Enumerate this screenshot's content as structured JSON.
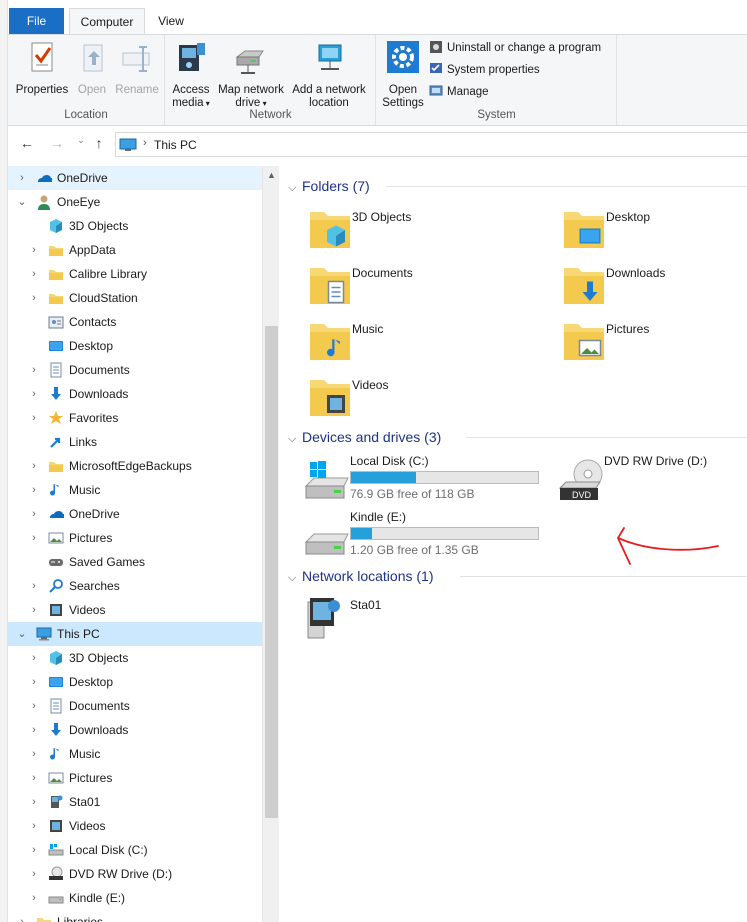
{
  "ribbon": {
    "tabs": [
      "File",
      "Computer",
      "View"
    ],
    "location": {
      "label": "Location",
      "properties": "Properties",
      "open": "Open",
      "rename": "Rename"
    },
    "network": {
      "label": "Network",
      "access_media_1": "Access",
      "access_media_2": "media",
      "map_drive_1": "Map network",
      "map_drive_2": "drive",
      "add_location_1": "Add a network",
      "add_location_2": "location"
    },
    "system": {
      "label": "System",
      "open_settings_1": "Open",
      "open_settings_2": "Settings",
      "uninstall": "Uninstall or change a program",
      "system_properties": "System properties",
      "manage": "Manage"
    }
  },
  "address": {
    "path": "This PC"
  },
  "nav": {
    "items": [
      {
        "label": "OneDrive",
        "icon": "onedrive-icon",
        "expanded": false
      },
      {
        "label": "OneEye",
        "icon": "user-icon",
        "expanded": true
      },
      {
        "label": "3D Objects",
        "icon": "3d-objects-icon"
      },
      {
        "label": "AppData",
        "icon": "folder-icon"
      },
      {
        "label": "Calibre Library",
        "icon": "folder-icon"
      },
      {
        "label": "CloudStation",
        "icon": "folder-icon"
      },
      {
        "label": "Contacts",
        "icon": "contacts-icon"
      },
      {
        "label": "Desktop",
        "icon": "desktop-icon"
      },
      {
        "label": "Documents",
        "icon": "documents-icon"
      },
      {
        "label": "Downloads",
        "icon": "downloads-icon"
      },
      {
        "label": "Favorites",
        "icon": "favorites-icon"
      },
      {
        "label": "Links",
        "icon": "links-icon"
      },
      {
        "label": "MicrosoftEdgeBackups",
        "icon": "folder-icon"
      },
      {
        "label": "Music",
        "icon": "music-icon"
      },
      {
        "label": "OneDrive",
        "icon": "onedrive-icon"
      },
      {
        "label": "Pictures",
        "icon": "pictures-icon"
      },
      {
        "label": "Saved Games",
        "icon": "saved-games-icon"
      },
      {
        "label": "Searches",
        "icon": "search-icon"
      },
      {
        "label": "Videos",
        "icon": "videos-icon"
      },
      {
        "label": "This PC",
        "icon": "this-pc-icon",
        "expanded": true
      },
      {
        "label": "3D Objects",
        "icon": "3d-objects-icon"
      },
      {
        "label": "Desktop",
        "icon": "desktop-icon"
      },
      {
        "label": "Documents",
        "icon": "documents-icon"
      },
      {
        "label": "Downloads",
        "icon": "downloads-icon"
      },
      {
        "label": "Music",
        "icon": "music-icon"
      },
      {
        "label": "Pictures",
        "icon": "pictures-icon"
      },
      {
        "label": "Sta01",
        "icon": "network-drive-icon"
      },
      {
        "label": "Videos",
        "icon": "videos-icon"
      },
      {
        "label": "Local Disk (C:)",
        "icon": "local-disk-icon"
      },
      {
        "label": "DVD RW Drive (D:)",
        "icon": "dvd-drive-icon"
      },
      {
        "label": "Kindle (E:)",
        "icon": "removable-drive-icon"
      },
      {
        "label": "Libraries",
        "icon": "libraries-icon"
      }
    ]
  },
  "sections": {
    "folders": "Folders (7)",
    "devices": "Devices and drives (3)",
    "network": "Network locations (1)"
  },
  "folders": [
    "3D Objects",
    "Desktop",
    "Documents",
    "Downloads",
    "Music",
    "Pictures",
    "Videos"
  ],
  "drives": [
    {
      "name": "Local Disk (C:)",
      "free": "76.9 GB free of 118 GB",
      "used_fraction": 0.35
    },
    {
      "name": "DVD RW Drive (D:)",
      "dvd_label": "DVD"
    },
    {
      "name": "Kindle (E:)",
      "free": "1.20 GB free of 1.35 GB",
      "used_fraction": 0.11
    }
  ],
  "network_locations": [
    "Sta01"
  ],
  "colors": {
    "accent": "#1a6fc4",
    "selection": "#cce8ff",
    "drive_bar": "#26a0da",
    "section_text": "#1e3287",
    "annotation": "#e81c1c"
  }
}
